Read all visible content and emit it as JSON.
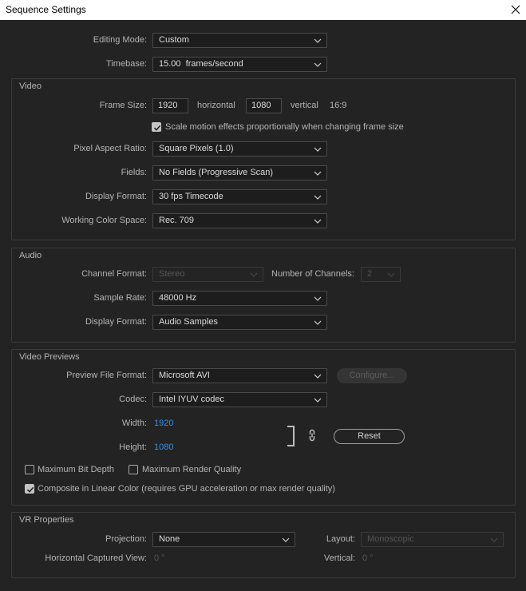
{
  "window": {
    "title": "Sequence Settings"
  },
  "general": {
    "editing_mode": {
      "label": "Editing Mode:",
      "value": "Custom"
    },
    "timebase": {
      "label": "Timebase:",
      "value": "15.00  frames/second"
    }
  },
  "video": {
    "title": "Video",
    "frame_size": {
      "label": "Frame Size:",
      "horizontal": "1920",
      "horizontal_label": "horizontal",
      "vertical": "1080",
      "vertical_label": "vertical",
      "aspect_ratio": "16:9"
    },
    "scale_motion": {
      "label": "Scale motion effects proportionally when changing frame size",
      "checked": true
    },
    "pixel_aspect_ratio": {
      "label": "Pixel Aspect Ratio:",
      "value": "Square Pixels (1.0)"
    },
    "fields": {
      "label": "Fields:",
      "value": "No Fields (Progressive Scan)"
    },
    "display_format": {
      "label": "Display Format:",
      "value": "30 fps Timecode"
    },
    "working_color_space": {
      "label": "Working Color Space:",
      "value": "Rec. 709"
    }
  },
  "audio": {
    "title": "Audio",
    "channel_format": {
      "label": "Channel Format:",
      "value": "Stereo",
      "disabled": true
    },
    "number_of_channels": {
      "label": "Number of Channels:",
      "value": "2",
      "disabled": true
    },
    "sample_rate": {
      "label": "Sample Rate:",
      "value": "48000 Hz"
    },
    "display_format": {
      "label": "Display Format:",
      "value": "Audio Samples"
    }
  },
  "video_previews": {
    "title": "Video Previews",
    "preview_file_format": {
      "label": "Preview File Format:",
      "value": "Microsoft AVI"
    },
    "configure_button": {
      "label": "Configure...",
      "disabled": true
    },
    "codec": {
      "label": "Codec:",
      "value": "Intel IYUV codec"
    },
    "width": {
      "label": "Width:",
      "value": "1920"
    },
    "height": {
      "label": "Height:",
      "value": "1080"
    },
    "reset_button": {
      "label": "Reset"
    },
    "maximum_bit_depth": {
      "label": "Maximum Bit Depth",
      "checked": false
    },
    "maximum_render_quality": {
      "label": "Maximum Render Quality",
      "checked": false
    },
    "composite_linear_color": {
      "label": "Composite in Linear Color (requires GPU acceleration or max render quality)",
      "checked": true
    }
  },
  "vr_properties": {
    "title": "VR Properties",
    "projection": {
      "label": "Projection:",
      "value": "None"
    },
    "layout": {
      "label": "Layout:",
      "value": "Monoscopic",
      "disabled": true
    },
    "horizontal_captured_view": {
      "label": "Horizontal Captured View:",
      "value": "0 °"
    },
    "vertical": {
      "label": "Vertical:",
      "value": "0 °"
    }
  },
  "colors": {
    "background": "#232323",
    "title_bar": "#ffffff",
    "value_accent": "#3a8fe0"
  },
  "icons": {
    "close": "close-icon",
    "dropdown": "chevron-down-icon",
    "check": "checkmark-icon",
    "constrain_proportions": "link-icon"
  }
}
